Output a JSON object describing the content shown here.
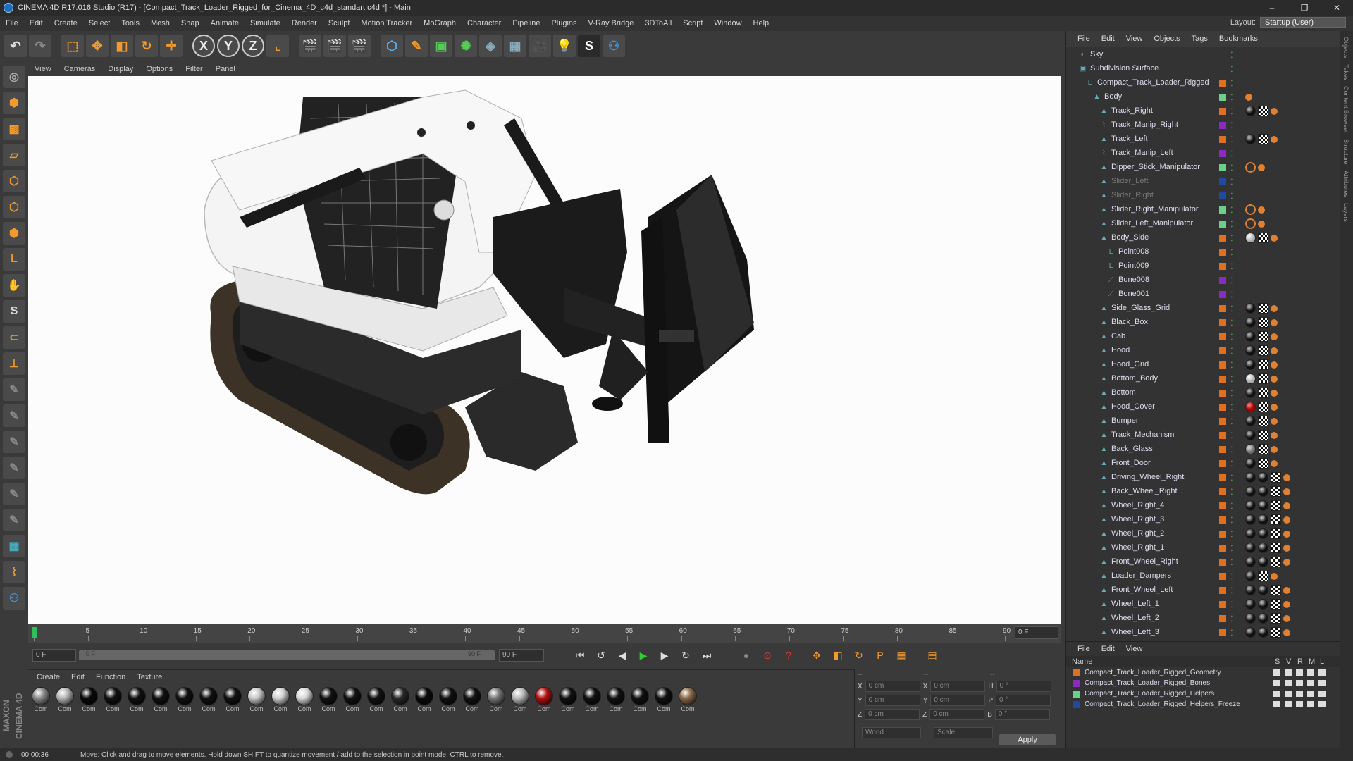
{
  "title": "CINEMA 4D R17.016 Studio (R17) - [Compact_Track_Loader_Rigged_for_Cinema_4D_c4d_standart.c4d *] - Main",
  "menu": [
    "File",
    "Edit",
    "Create",
    "Select",
    "Tools",
    "Mesh",
    "Snap",
    "Animate",
    "Simulate",
    "Render",
    "Sculpt",
    "Motion Tracker",
    "MoGraph",
    "Character",
    "Pipeline",
    "Plugins",
    "V-Ray Bridge",
    "3DToAll",
    "Script",
    "Window",
    "Help"
  ],
  "layout": {
    "label": "Layout:",
    "value": "Startup (User)"
  },
  "viewport_menu": [
    "View",
    "Cameras",
    "Display",
    "Options",
    "Filter",
    "Panel"
  ],
  "timeline": {
    "ticks": [
      "0",
      "5",
      "10",
      "15",
      "20",
      "25",
      "30",
      "35",
      "40",
      "45",
      "50",
      "55",
      "60",
      "65",
      "70",
      "75",
      "80",
      "85",
      "90"
    ],
    "current_frame": "0 F"
  },
  "transport": {
    "start": "0 F",
    "range_start": "0 F",
    "range_end": "90 F",
    "end": "90 F"
  },
  "materials": {
    "menu": [
      "Create",
      "Edit",
      "Function",
      "Texture"
    ],
    "label": "Com",
    "colors": [
      "#8a8a8a",
      "#b5b5b5",
      "#0a0a0a",
      "#111",
      "#111",
      "#111",
      "#111",
      "#111",
      "#111",
      "#c8c8c8",
      "#d0d0d0",
      "#d8d8d8",
      "#111",
      "#111",
      "#111",
      "#2a2a2a",
      "#0a0a0a",
      "#111",
      "#111",
      "#777",
      "#bbb",
      "#b01010",
      "#111",
      "#111",
      "#111",
      "#111",
      "#111",
      "#8a6a4a"
    ]
  },
  "coords": {
    "rows": [
      {
        "a": "X",
        "av": "0 cm",
        "b": "X",
        "bv": "0 cm",
        "c": "H",
        "cv": "0 °"
      },
      {
        "a": "Y",
        "av": "0 cm",
        "b": "Y",
        "bv": "0 cm",
        "c": "P",
        "cv": "0 °"
      },
      {
        "a": "Z",
        "av": "0 cm",
        "b": "Z",
        "bv": "0 cm",
        "c": "B",
        "cv": "0 °"
      }
    ],
    "dashes": [
      "--",
      "--",
      "--"
    ],
    "world": "World",
    "scale": "Scale",
    "apply": "Apply"
  },
  "object_manager": {
    "menu": [
      "File",
      "Edit",
      "View",
      "Objects",
      "Tags",
      "Bookmarks"
    ],
    "objects": [
      {
        "name": "Sky",
        "indent": 0,
        "icon": "sky-icon",
        "layer": "",
        "tags": [],
        "dim": false
      },
      {
        "name": "Subdivision Surface",
        "indent": 0,
        "icon": "subdivision-icon",
        "layer": "",
        "tags": [],
        "dim": false
      },
      {
        "name": "Compact_Track_Loader_Rigged",
        "indent": 1,
        "icon": "null-icon",
        "layer": "#e07020",
        "tags": [],
        "dim": false
      },
      {
        "name": "Body",
        "indent": 2,
        "icon": "poly-icon",
        "layer": "#6bd08a",
        "tags": [
          "or"
        ],
        "dim": false
      },
      {
        "name": "Track_Right",
        "indent": 3,
        "icon": "poly-icon",
        "layer": "#e07020",
        "tags": [
          "bk",
          "ck",
          "or"
        ],
        "dim": false
      },
      {
        "name": "Track_Manip_Right",
        "indent": 3,
        "icon": "spline-icon",
        "layer": "#8a2ac0",
        "tags": [],
        "dim": false
      },
      {
        "name": "Track_Left",
        "indent": 3,
        "icon": "poly-icon",
        "layer": "#e07020",
        "tags": [
          "bk",
          "ck",
          "or"
        ],
        "dim": false
      },
      {
        "name": "Track_Manip_Left",
        "indent": 3,
        "icon": "spline-icon",
        "layer": "#8a2ac0",
        "tags": [],
        "dim": false
      },
      {
        "name": "Dipper_Stick_Manipulator",
        "indent": 3,
        "icon": "poly-icon",
        "layer": "#6bd08a",
        "tags": [
          "no",
          "or"
        ],
        "dim": false
      },
      {
        "name": "Slider_Left",
        "indent": 3,
        "icon": "poly-icon",
        "layer": "#1e4aa0",
        "tags": [],
        "dim": true
      },
      {
        "name": "Slider_Right",
        "indent": 3,
        "icon": "poly-icon",
        "layer": "#1e4aa0",
        "tags": [],
        "dim": true
      },
      {
        "name": "Slider_Right_Manipulator",
        "indent": 3,
        "icon": "poly-icon",
        "layer": "#6bd08a",
        "tags": [
          "no",
          "or"
        ],
        "dim": false
      },
      {
        "name": "Slider_Left_Manipulator",
        "indent": 3,
        "icon": "poly-icon",
        "layer": "#6bd08a",
        "tags": [
          "no",
          "or"
        ],
        "dim": false
      },
      {
        "name": "Body_Side",
        "indent": 3,
        "icon": "poly-icon",
        "layer": "#e07020",
        "tags": [
          "wh",
          "ck",
          "or"
        ],
        "dim": false
      },
      {
        "name": "Point008",
        "indent": 4,
        "icon": "null-icon",
        "layer": "#e07020",
        "tags": [],
        "dim": false
      },
      {
        "name": "Point009",
        "indent": 4,
        "icon": "null-icon",
        "layer": "#e07020",
        "tags": [],
        "dim": false
      },
      {
        "name": "Bone008",
        "indent": 4,
        "icon": "bone-icon",
        "layer": "#8a2ac0",
        "tags": [],
        "dim": false
      },
      {
        "name": "Bone001",
        "indent": 4,
        "icon": "bone-icon",
        "layer": "#8a2ac0",
        "tags": [],
        "dim": false
      },
      {
        "name": "Side_Glass_Grid",
        "indent": 3,
        "icon": "poly-icon",
        "layer": "#e07020",
        "tags": [
          "bk",
          "ck",
          "or"
        ],
        "dim": false
      },
      {
        "name": "Black_Box",
        "indent": 3,
        "icon": "poly-icon",
        "layer": "#e07020",
        "tags": [
          "bk",
          "ck",
          "or"
        ],
        "dim": false
      },
      {
        "name": "Cab",
        "indent": 3,
        "icon": "poly-icon",
        "layer": "#e07020",
        "tags": [
          "bk",
          "ck",
          "or"
        ],
        "dim": false
      },
      {
        "name": "Hood",
        "indent": 3,
        "icon": "poly-icon",
        "layer": "#e07020",
        "tags": [
          "bk",
          "ck",
          "or"
        ],
        "dim": false
      },
      {
        "name": "Hood_Grid",
        "indent": 3,
        "icon": "poly-icon",
        "layer": "#e07020",
        "tags": [
          "bk",
          "ck",
          "or"
        ],
        "dim": false
      },
      {
        "name": "Bottom_Body",
        "indent": 3,
        "icon": "poly-icon",
        "layer": "#e07020",
        "tags": [
          "wh",
          "ck",
          "or"
        ],
        "dim": false
      },
      {
        "name": "Bottom",
        "indent": 3,
        "icon": "poly-icon",
        "layer": "#e07020",
        "tags": [
          "bk",
          "ck",
          "or"
        ],
        "dim": false
      },
      {
        "name": "Hood_Cover",
        "indent": 3,
        "icon": "poly-icon",
        "layer": "#e07020",
        "tags": [
          "rd",
          "ck",
          "or"
        ],
        "dim": false
      },
      {
        "name": "Bumper",
        "indent": 3,
        "icon": "poly-icon",
        "layer": "#e07020",
        "tags": [
          "bk",
          "ck",
          "or"
        ],
        "dim": false
      },
      {
        "name": "Track_Mechanism",
        "indent": 3,
        "icon": "poly-icon",
        "layer": "#e07020",
        "tags": [
          "bk",
          "ck",
          "or"
        ],
        "dim": false
      },
      {
        "name": "Back_Glass",
        "indent": 3,
        "icon": "poly-icon",
        "layer": "#e07020",
        "tags": [
          "gr",
          "ck",
          "or"
        ],
        "dim": false
      },
      {
        "name": "Front_Door",
        "indent": 3,
        "icon": "poly-icon",
        "layer": "#e07020",
        "tags": [
          "bk",
          "ck",
          "or"
        ],
        "dim": false
      },
      {
        "name": "Driving_Wheel_Right",
        "indent": 3,
        "icon": "poly-icon",
        "layer": "#e07020",
        "tags": [
          "bk",
          "bk",
          "ck",
          "or"
        ],
        "dim": false
      },
      {
        "name": "Back_Wheel_Right",
        "indent": 3,
        "icon": "poly-icon",
        "layer": "#e07020",
        "tags": [
          "bk",
          "bk",
          "ck",
          "or"
        ],
        "dim": false
      },
      {
        "name": "Wheel_Right_4",
        "indent": 3,
        "icon": "poly-icon",
        "layer": "#e07020",
        "tags": [
          "bk",
          "bk",
          "ck",
          "or"
        ],
        "dim": false
      },
      {
        "name": "Wheel_Right_3",
        "indent": 3,
        "icon": "poly-icon",
        "layer": "#e07020",
        "tags": [
          "bk",
          "bk",
          "ck",
          "or"
        ],
        "dim": false
      },
      {
        "name": "Wheel_Right_2",
        "indent": 3,
        "icon": "poly-icon",
        "layer": "#e07020",
        "tags": [
          "bk",
          "bk",
          "ck",
          "or"
        ],
        "dim": false
      },
      {
        "name": "Wheel_Right_1",
        "indent": 3,
        "icon": "poly-icon",
        "layer": "#e07020",
        "tags": [
          "bk",
          "bk",
          "ck",
          "or"
        ],
        "dim": false
      },
      {
        "name": "Front_Wheel_Right",
        "indent": 3,
        "icon": "poly-icon",
        "layer": "#e07020",
        "tags": [
          "bk",
          "bk",
          "ck",
          "or"
        ],
        "dim": false
      },
      {
        "name": "Loader_Dampers",
        "indent": 3,
        "icon": "poly-icon",
        "layer": "#e07020",
        "tags": [
          "bk",
          "ck",
          "or"
        ],
        "dim": false
      },
      {
        "name": "Front_Wheel_Left",
        "indent": 3,
        "icon": "poly-icon",
        "layer": "#e07020",
        "tags": [
          "bk",
          "bk",
          "ck",
          "or"
        ],
        "dim": false
      },
      {
        "name": "Wheel_Left_1",
        "indent": 3,
        "icon": "poly-icon",
        "layer": "#e07020",
        "tags": [
          "bk",
          "bk",
          "ck",
          "or"
        ],
        "dim": false
      },
      {
        "name": "Wheel_Left_2",
        "indent": 3,
        "icon": "poly-icon",
        "layer": "#e07020",
        "tags": [
          "bk",
          "bk",
          "ck",
          "or"
        ],
        "dim": false
      },
      {
        "name": "Wheel_Left_3",
        "indent": 3,
        "icon": "poly-icon",
        "layer": "#e07020",
        "tags": [
          "bk",
          "bk",
          "ck",
          "or"
        ],
        "dim": false
      }
    ]
  },
  "layer_manager": {
    "menu": [
      "File",
      "Edit",
      "View"
    ],
    "columns": [
      "Name",
      "S",
      "V",
      "R",
      "M",
      "L"
    ],
    "layers": [
      {
        "name": "Compact_Track_Loader_Rigged_Geometry",
        "color": "#e07020"
      },
      {
        "name": "Compact_Track_Loader_Rigged_Bones",
        "color": "#8a2ac0"
      },
      {
        "name": "Compact_Track_Loader_Rigged_Helpers",
        "color": "#6bd08a"
      },
      {
        "name": "Compact_Track_Loader_Rigged_Helpers_Freeze",
        "color": "#1e4aa0"
      }
    ]
  },
  "side_tabs": [
    "Objects",
    "Takes",
    "Content Browser",
    "Structure",
    "Attributes",
    "Layers"
  ],
  "status": {
    "time": "00:00:36",
    "message": "Move: Click and drag to move elements. Hold down SHIFT to quantize movement / add to the selection in point mode, CTRL to remove."
  },
  "brand": "MAXON CINEMA 4D"
}
